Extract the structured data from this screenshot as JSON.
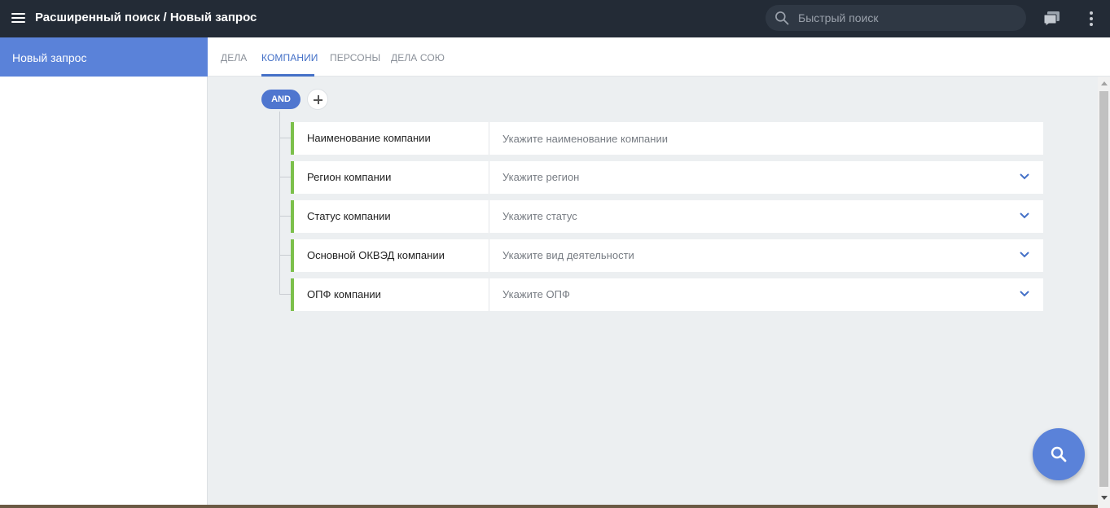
{
  "header": {
    "title": "Расширенный поиск / Новый запрос",
    "search_placeholder": "Быстрый поиск",
    "bg_color": "#232b36",
    "icons": [
      "menu-icon",
      "search-icon",
      "chat-icon",
      "more-vertical-icon"
    ]
  },
  "sidebar": {
    "items": [
      {
        "label": "Новый запрос",
        "active": true
      }
    ],
    "active_color": "#5a82d9"
  },
  "tabs": [
    {
      "label": "ДЕЛА",
      "active": false
    },
    {
      "label": "КОМПАНИИ",
      "active": true
    },
    {
      "label": "ПЕРСОНЫ",
      "active": false
    },
    {
      "label": "ДЕЛА СОЮ",
      "active": false
    }
  ],
  "query": {
    "operator": "AND",
    "criteria": [
      {
        "label": "Наименование компании",
        "placeholder": "Укажите наименование компании",
        "type": "text"
      },
      {
        "label": "Регион компании",
        "placeholder": "Укажите регион",
        "type": "select"
      },
      {
        "label": "Статус компании",
        "placeholder": "Укажите статус",
        "type": "select"
      },
      {
        "label": "Основной ОКВЭД компании",
        "placeholder": "Укажите вид деятельности",
        "type": "select"
      },
      {
        "label": "ОПФ компании",
        "placeholder": "Укажите ОПФ",
        "type": "select"
      }
    ],
    "criterion_accent": "#7cc04b"
  },
  "accent_color": "#4470c7",
  "fab": {
    "icon": "search-icon"
  }
}
